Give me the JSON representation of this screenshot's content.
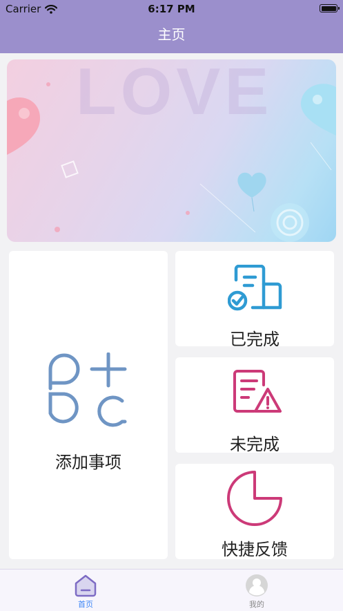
{
  "status": {
    "carrier": "Carrier",
    "time": "6:17 PM"
  },
  "header": {
    "title": "主页"
  },
  "banner": {
    "watermark": "LOVE"
  },
  "cards": {
    "add": {
      "label": "添加事项",
      "icon": "add-items-icon",
      "color": "#6f95c4"
    },
    "done": {
      "label": "已完成",
      "icon": "document-check-icon",
      "color": "#2f9bd3"
    },
    "undone": {
      "label": "未完成",
      "icon": "document-warning-icon",
      "color": "#cc3a78"
    },
    "feedback": {
      "label": "快捷反馈",
      "icon": "pie-chart-icon",
      "color": "#cc3a78"
    }
  },
  "tabs": [
    {
      "label": "首页",
      "icon": "home-icon",
      "active": true,
      "color": "#3e86f5"
    },
    {
      "label": "我的",
      "icon": "profile-icon",
      "active": false,
      "color": "#888888"
    }
  ]
}
